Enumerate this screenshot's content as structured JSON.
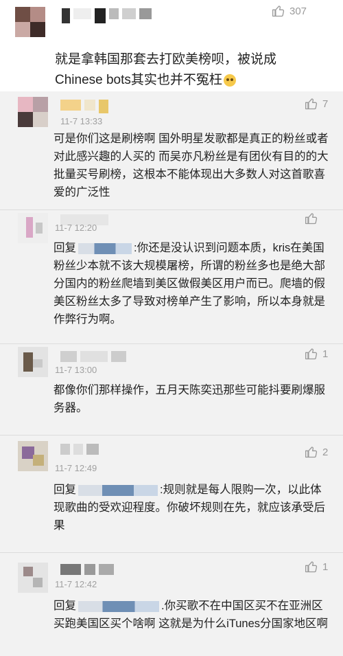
{
  "comments": [
    {
      "time": "",
      "likes": "307",
      "text_lines": [
        "就是拿韩国那套去打欧美榜呗，被说成",
        "Chinese bots其实也并不冤枉"
      ]
    },
    {
      "time": "11-7 13:33",
      "likes": "7",
      "text": "可是你们这是刷榜啊 国外明星发歌都是真正的粉丝或者对此感兴趣的人买的 而吴亦凡粉丝是有团伙有目的的大批量买号刷榜，这根本不能体现出大多数人对这首歌喜爱的广泛性"
    },
    {
      "time": "11-7 12:20",
      "likes": "",
      "prefix": "回复",
      "text": ":你还是没认识到问题本质，kris在美国粉丝少本就不该大规模屠榜，所谓的粉丝多也是绝大部分国内的粉丝爬墙到美区做假美区用户而已。爬墙的假美区粉丝太多了导致对榜单产生了影响，所以本身就是作弊行为啊。"
    },
    {
      "time": "11-7 13:00",
      "likes": "1",
      "text": "都像你们那样操作，五月天陈奕迅那些可能抖要刷爆服务器。"
    },
    {
      "time": "11-7 12:49",
      "likes": "2",
      "prefix": "回复",
      "text": ":规则就是每人限购一次，以此体现歌曲的受欢迎程度。你破坏规则在先，就应该承受后果"
    },
    {
      "time": "11-7 12:42",
      "likes": "1",
      "prefix": "回复",
      "text": ".你买歌不在中国区买不在亚洲区买跑美国区买个啥啊 这就是为什么iTunes分国家地区啊"
    }
  ],
  "colors": {
    "reply_bg": "#f2f2f2",
    "time": "#a0a0a0",
    "like": "#9a9a9a"
  }
}
